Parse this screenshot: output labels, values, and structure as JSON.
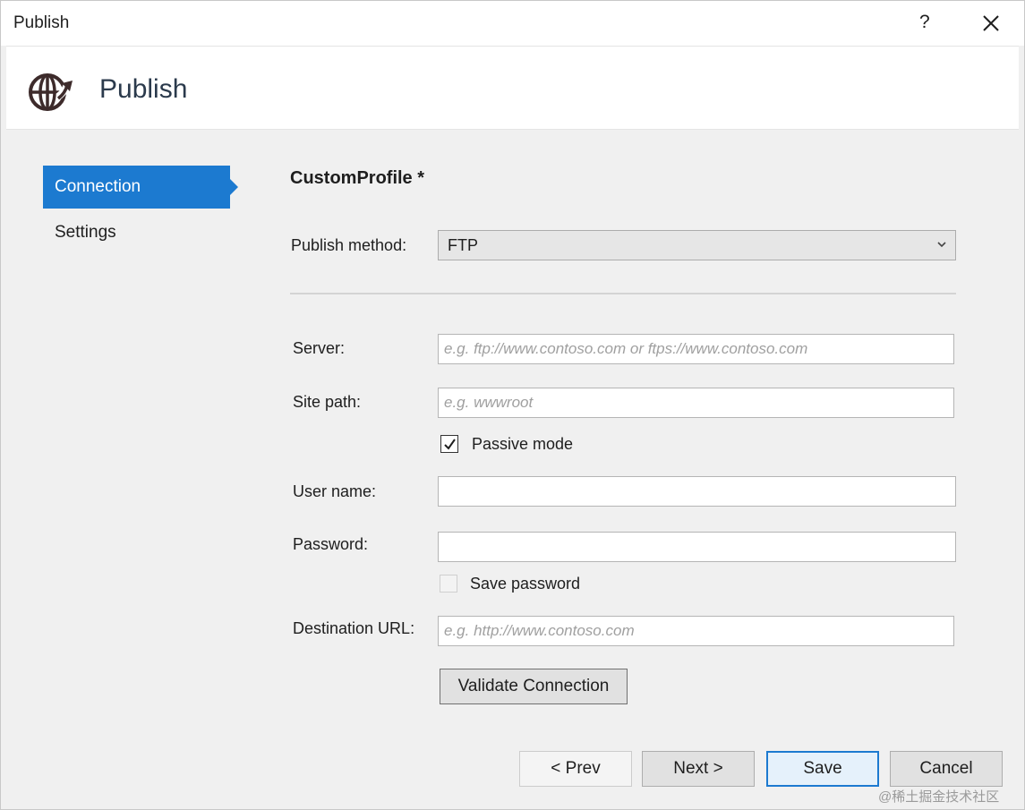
{
  "window": {
    "title": "Publish",
    "help_label": "?"
  },
  "header": {
    "title": "Publish",
    "icon": "globe-publish-icon"
  },
  "nav": {
    "items": [
      {
        "label": "Connection",
        "active": true
      },
      {
        "label": "Settings",
        "active": false
      }
    ]
  },
  "form": {
    "profile_title": "CustomProfile *",
    "publish_method": {
      "label": "Publish method:",
      "value": "FTP"
    },
    "server": {
      "label": "Server:",
      "value": "",
      "placeholder": "e.g. ftp://www.contoso.com or ftps://www.contoso.com"
    },
    "site_path": {
      "label": "Site path:",
      "value": "",
      "placeholder": "e.g. wwwroot"
    },
    "passive_mode": {
      "label": "Passive mode",
      "checked": true
    },
    "user_name": {
      "label": "User name:",
      "value": ""
    },
    "password": {
      "label": "Password:",
      "value": ""
    },
    "save_password": {
      "label": "Save password",
      "checked": false
    },
    "destination_url": {
      "label": "Destination URL:",
      "value": "",
      "placeholder": "e.g. http://www.contoso.com"
    },
    "validate_label": "Validate Connection"
  },
  "footer": {
    "prev_label": "< Prev",
    "next_label": "Next >",
    "save_label": "Save",
    "cancel_label": "Cancel"
  },
  "watermark": "@稀土掘金技术社区",
  "colors": {
    "accent": "#1c7ad0",
    "background": "#f0f0f0"
  }
}
